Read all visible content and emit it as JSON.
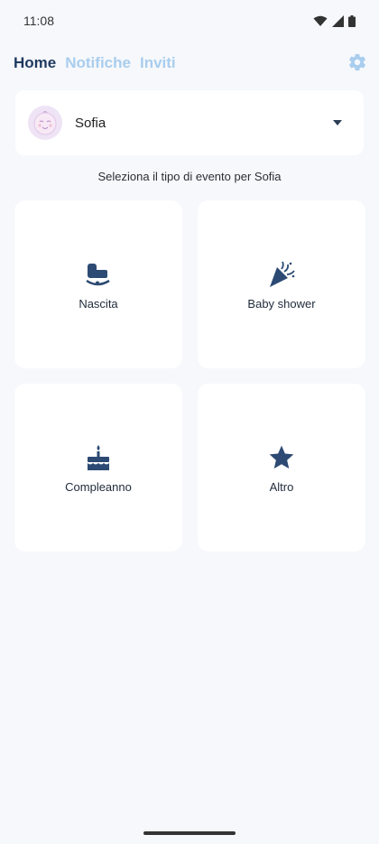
{
  "status_bar": {
    "time": "11:08"
  },
  "nav": {
    "tabs": [
      {
        "label": "Home",
        "active": true
      },
      {
        "label": "Notifiche",
        "active": false
      },
      {
        "label": "Inviti",
        "active": false
      }
    ],
    "settings_icon": "gear-icon"
  },
  "profile": {
    "name": "Sofia",
    "avatar_icon": "baby-face-icon",
    "dropdown_icon": "caret-down-icon"
  },
  "subtitle": "Seleziona il tipo di evento per Sofia",
  "events": [
    {
      "label": "Nascita",
      "icon": "cradle-icon"
    },
    {
      "label": "Baby shower",
      "icon": "party-popper-icon"
    },
    {
      "label": "Compleanno",
      "icon": "birthday-cake-icon"
    },
    {
      "label": "Altro",
      "icon": "star-icon"
    }
  ],
  "colors": {
    "accent": "#1f3a5f",
    "inactive_tab": "#a9cdee",
    "icon": "#2c4a73",
    "background": "#f6f8fb"
  }
}
